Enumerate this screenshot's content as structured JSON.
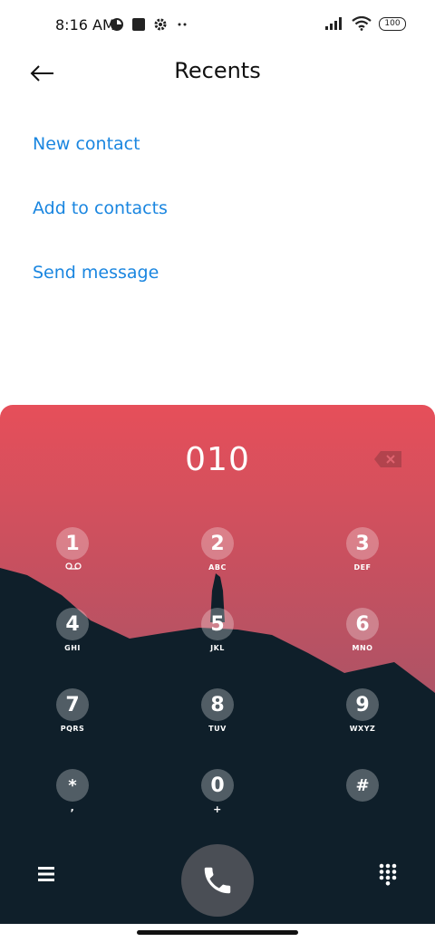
{
  "status_bar": {
    "time": "8:16 AM",
    "battery": "100",
    "icons_left": [
      "alarm-icon",
      "app-square-icon",
      "settings-icon",
      "more-dots-icon"
    ],
    "icons_right": [
      "signal-icon",
      "wifi-icon",
      "battery-icon"
    ]
  },
  "header": {
    "title": "Recents",
    "back_icon": "arrow-left-icon"
  },
  "actions": [
    {
      "label": "New contact"
    },
    {
      "label": "Add to contacts"
    },
    {
      "label": "Send message"
    }
  ],
  "dialpad": {
    "number": "010",
    "backspace_icon": "backspace-icon",
    "keys": [
      {
        "digit": "1",
        "sub": "voicemail-icon"
      },
      {
        "digit": "2",
        "sub": "ABC"
      },
      {
        "digit": "3",
        "sub": "DEF"
      },
      {
        "digit": "4",
        "sub": "GHI"
      },
      {
        "digit": "5",
        "sub": "JKL"
      },
      {
        "digit": "6",
        "sub": "MNO"
      },
      {
        "digit": "7",
        "sub": "PQRS"
      },
      {
        "digit": "8",
        "sub": "TUV"
      },
      {
        "digit": "9",
        "sub": "WXYZ"
      },
      {
        "digit": "*",
        "sub": ","
      },
      {
        "digit": "0",
        "sub": "+"
      },
      {
        "digit": "#",
        "sub": ""
      }
    ]
  },
  "bottom_bar": {
    "menu_icon": "menu-icon",
    "call_icon": "phone-icon",
    "keypad_icon": "dialpad-icon"
  },
  "colors": {
    "accent": "#1a86e0",
    "call_button": "#4a4e55",
    "landscape": "#0f1f2a"
  }
}
